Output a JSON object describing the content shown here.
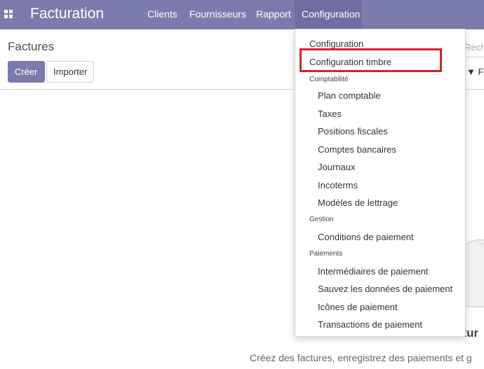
{
  "navbar": {
    "app_title": "Facturation",
    "menu": {
      "clients": "Clients",
      "fournisseurs": "Fournisseurs",
      "rapport": "Rapport",
      "configuration": "Configuration"
    },
    "color": "#7c7bad"
  },
  "control_panel": {
    "breadcrumb": "Factures",
    "create_label": "Créer",
    "import_label": "Importer",
    "search_fragment": "Rech",
    "filter_fragment": "Fi"
  },
  "helper": {
    "title_fragment": "ctur",
    "text": "Créez des factures, enregistrez des paiements et g"
  },
  "dropdown": {
    "configuration": "Configuration",
    "configuration_timbre": "Configuration timbre",
    "section_comptabilite": "Comptabilité",
    "comptabilite": [
      "Plan comptable",
      "Taxes",
      "Positions fiscales",
      "Comptes bancaires",
      "Journaux",
      "Incoterms",
      "Modèles de lettrage"
    ],
    "section_gestion": "Gestion",
    "gestion": [
      "Conditions de paiement"
    ],
    "section_paiements": "Paiements",
    "paiements": [
      "Intermédiaires de paiement",
      "Sauvez les données de paiement",
      "Icônes de paiement",
      "Transactions de paiement"
    ]
  },
  "highlight_color": "#d9212a"
}
